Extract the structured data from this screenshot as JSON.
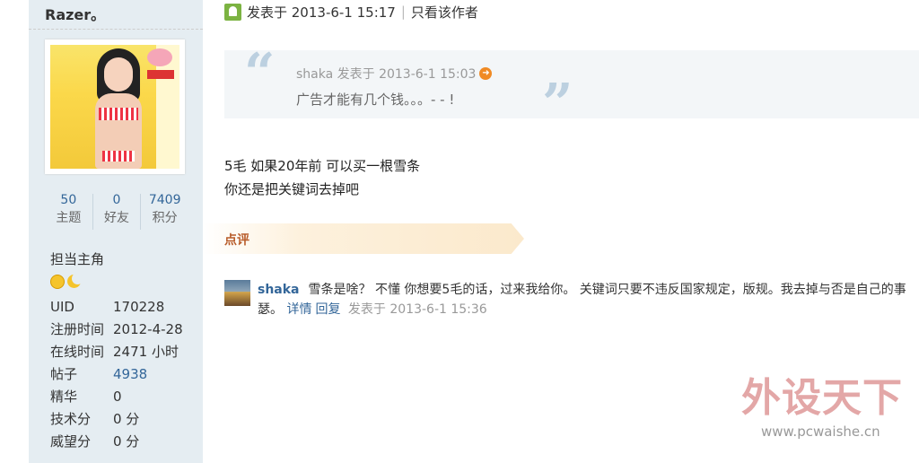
{
  "profile": {
    "username": "Razer。",
    "stats": [
      {
        "value": "50",
        "label": "主题"
      },
      {
        "value": "0",
        "label": "好友"
      },
      {
        "value": "7409",
        "label": "积分"
      }
    ],
    "rank": "担当主角",
    "info": [
      {
        "key": "UID",
        "value": "170228"
      },
      {
        "key": "注册时间",
        "value": "2012-4-28"
      },
      {
        "key": "在线时间",
        "value": "2471 小时"
      },
      {
        "key": "帖子",
        "value": "4938"
      },
      {
        "key": "精华",
        "value": "0"
      },
      {
        "key": "技术分",
        "value": "0 分"
      },
      {
        "key": "威望分",
        "value": "0 分"
      }
    ]
  },
  "post": {
    "meta_time": "发表于 2013-6-1 15:17",
    "only_author": "只看该作者",
    "quote": {
      "meta": "shaka 发表于 2013-6-1 15:03",
      "text": "广告才能有几个钱。。。- - !"
    },
    "message": [
      "5毛 如果20年前 可以买一根雪条",
      "你还是把关键词去掉吧"
    ]
  },
  "rating": {
    "label": "点评"
  },
  "comment": {
    "user": "shaka",
    "text_line1": "雪条是啥？ 不懂 你想要5毛的话，过来我给你。 关键词只要不违反国家规定，版规。我去掉与否是自己的事",
    "text_line2": "瑟。",
    "details_link": "详情",
    "reply_link": "回复",
    "time": "发表于 2013-6-1 15:36"
  },
  "watermark": {
    "brand": "外设天下",
    "url": "www.pcwaishe.cn"
  },
  "icons": {
    "online": "online-user-icon",
    "quote_jump": "jump-to-post-icon",
    "rank_sun": "sun-rank-icon",
    "rank_moon": "moon-rank-icon"
  }
}
